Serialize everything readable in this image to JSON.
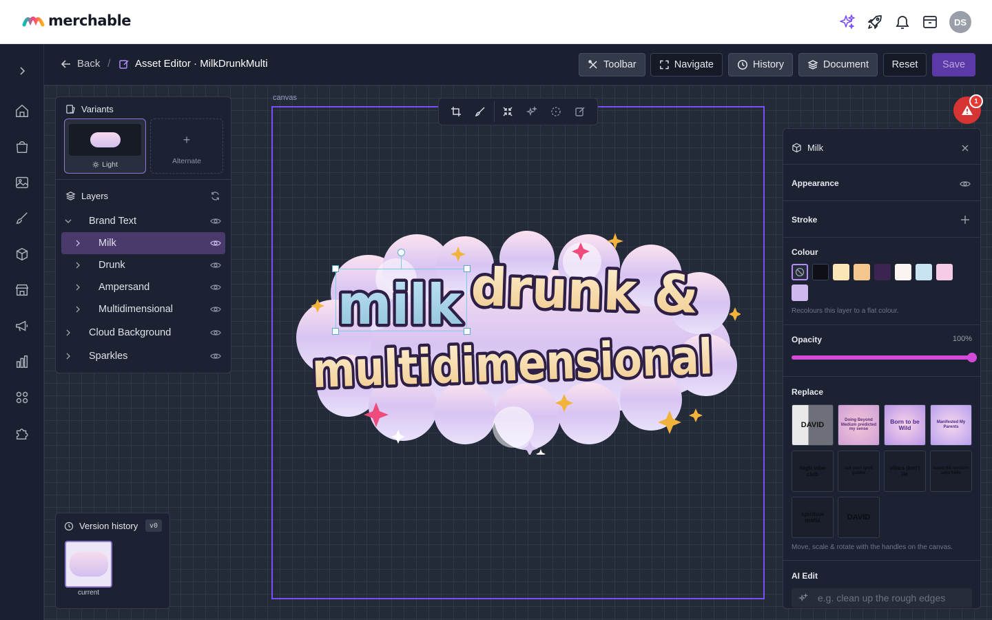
{
  "brand": {
    "name": "merchable"
  },
  "header": {
    "avatar_initials": "DS",
    "icons": [
      "sparkles-icon",
      "rocket-icon",
      "bell-icon",
      "inbox-icon"
    ]
  },
  "nav": {
    "icons": [
      "expand-icon",
      "home-icon",
      "shopping-bag-icon",
      "image-icon",
      "brush-icon",
      "box-icon",
      "store-icon",
      "megaphone-icon",
      "chart-icon",
      "apps-icon",
      "puzzle-icon"
    ]
  },
  "subbar": {
    "back_label": "Back",
    "breadcrumb_sep": "/",
    "title": "Asset Editor · MilkDrunkMulti",
    "buttons": {
      "toolbar": "Toolbar",
      "navigate": "Navigate",
      "history": "History",
      "document": "Document",
      "reset": "Reset",
      "save": "Save"
    }
  },
  "canvas": {
    "label": "canvas",
    "alert_count": "1",
    "artwork": {
      "line1_a": "milk",
      "line1_b": "drunk &",
      "line2": "multidimensional"
    }
  },
  "variants": {
    "title": "Variants",
    "items": [
      {
        "label": "Light",
        "selected": true
      },
      {
        "label": "Alternate",
        "selected": false
      }
    ]
  },
  "layers": {
    "title": "Layers",
    "items": [
      {
        "label": "Brand Text",
        "depth": 0,
        "expanded": true,
        "selected": false
      },
      {
        "label": "Milk",
        "depth": 1,
        "selected": true
      },
      {
        "label": "Drunk",
        "depth": 1,
        "selected": false
      },
      {
        "label": "Ampersand",
        "depth": 1,
        "selected": false
      },
      {
        "label": "Multidimensional",
        "depth": 1,
        "selected": false
      },
      {
        "label": "Cloud Background",
        "depth": 0,
        "selected": false
      },
      {
        "label": "Sparkles",
        "depth": 0,
        "selected": false
      }
    ]
  },
  "version_history": {
    "title": "Version history",
    "version": "v0",
    "current_label": "current"
  },
  "inspector": {
    "title": "Milk",
    "appearance": "Appearance",
    "stroke": "Stroke",
    "colour": "Colour",
    "colours": [
      "#0f0f18",
      "#fbe7b5",
      "#f4c58d",
      "#3b2550",
      "#fbf4f1",
      "#c7e3f2",
      "#f6cbe7",
      "#cfb8f0"
    ],
    "colour_hint": "Recolours this layer to a flat colour.",
    "opacity_label": "Opacity",
    "opacity_value": "100%",
    "opacity_fraction": 1.0,
    "replace": "Replace",
    "replace_items": [
      "DAVID",
      "Doing Beyond Medium predicted my sense",
      "Born to be Wild",
      "Manifested My Parents",
      "high vibe club",
      "ask your spirit guides",
      "vibes don't lie",
      "could the medium says hello",
      "spiritual mafia",
      "DAVID"
    ],
    "replace_hint": "Move, scale & rotate with the handles on the canvas.",
    "ai_edit": "AI Edit",
    "ai_placeholder": "e.g. clean up the rough edges"
  },
  "colors": {
    "accent": "#7c4dff",
    "selected_layer": "#4a3a6c",
    "save": "#5b3aa8",
    "alert": "#e53935"
  }
}
